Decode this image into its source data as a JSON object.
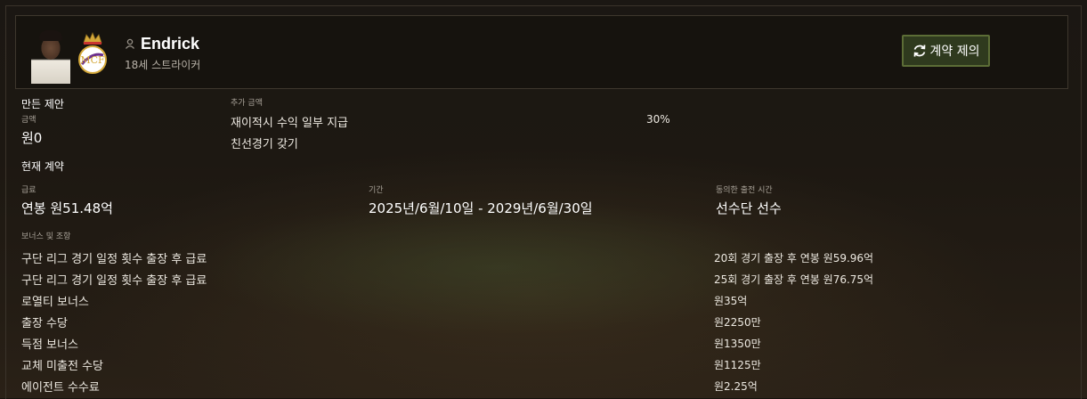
{
  "player": {
    "name": "Endrick",
    "meta": "18세 스트라이커"
  },
  "actions": {
    "offer_label": "계약 제의"
  },
  "offer": {
    "section_title": "만든 제안",
    "amount_label": "금액",
    "amount_value": "원0",
    "extras_label": "추가 금액",
    "extras": [
      {
        "label": "재이적시 수익 일부 지급",
        "value": "30%"
      },
      {
        "label": "친선경기 갖기",
        "value": ""
      }
    ]
  },
  "contract": {
    "section_title": "현재 계약",
    "wage_label": "급료",
    "wage_value": "연봉 원51.48억",
    "period_label": "기간",
    "period_value": "2025년/6월/10일 - 2029년/6월/30일",
    "playing_time_label": "동의한 출전 시간",
    "playing_time_value": "선수단 선수",
    "bonuses_label": "보너스 및 조항",
    "bonuses": [
      {
        "label": "구단 리그 경기 일정 횟수 출장 후 급료",
        "value": "20회 경기 출장 후 연봉 원59.96억"
      },
      {
        "label": "구단 리그 경기 일정 횟수 출장 후 급료",
        "value": "25회 경기 출장 후 연봉 원76.75억"
      },
      {
        "label": "로열티 보너스",
        "value": "원35억"
      },
      {
        "label": "출장 수당",
        "value": "원2250만"
      },
      {
        "label": "득점 보너스",
        "value": "원1350만"
      },
      {
        "label": "교체 미출전 수당",
        "value": "원1125만"
      },
      {
        "label": "에이전트 수수료",
        "value": "원2.25억"
      }
    ]
  },
  "colors": {
    "accent_button": "#2f3a1e",
    "accent_border": "#5c6d36",
    "background": "#17130f"
  },
  "icons": {
    "person": "person-icon",
    "refresh": "refresh-icon",
    "crest": "club-crest"
  }
}
